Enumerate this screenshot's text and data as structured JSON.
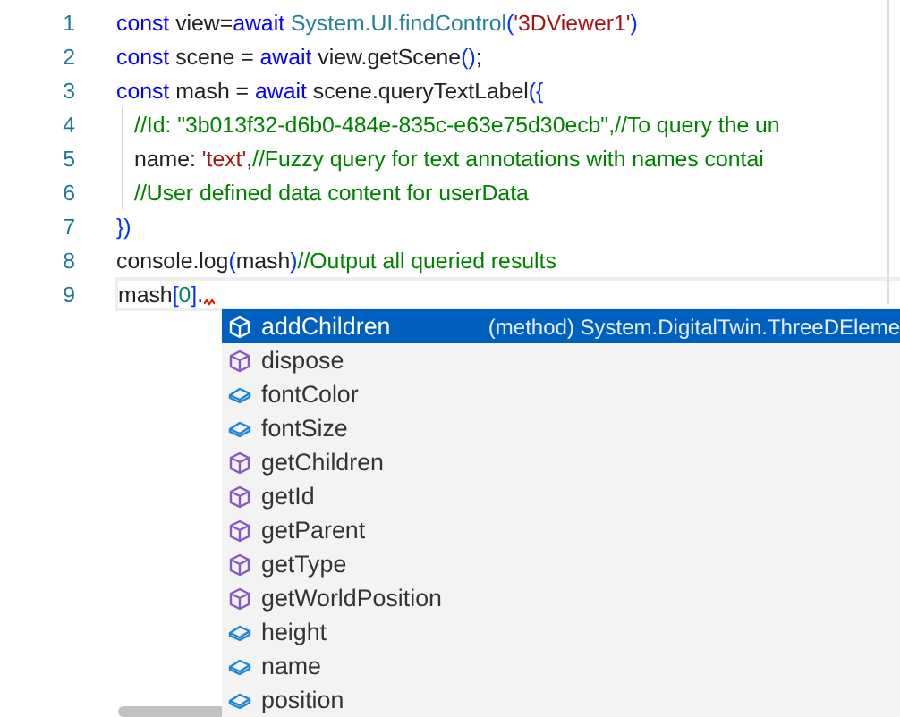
{
  "editor": {
    "lines": [
      {
        "number": "1",
        "indent": false,
        "tokens": [
          {
            "kind": "keyword",
            "text": "const"
          },
          {
            "kind": "plain",
            "text": " view="
          },
          {
            "kind": "keyword",
            "text": "await"
          },
          {
            "kind": "type",
            "text": " System.UI.findControl"
          },
          {
            "kind": "bracket",
            "text": "("
          },
          {
            "kind": "string",
            "text": "'3DViewer1'"
          },
          {
            "kind": "bracket",
            "text": ")"
          }
        ]
      },
      {
        "number": "2",
        "indent": false,
        "tokens": [
          {
            "kind": "keyword",
            "text": "const"
          },
          {
            "kind": "plain",
            "text": " scene = "
          },
          {
            "kind": "keyword",
            "text": "await"
          },
          {
            "kind": "plain",
            "text": " view.getScene"
          },
          {
            "kind": "bracket",
            "text": "()"
          },
          {
            "kind": "plain",
            "text": ";"
          }
        ]
      },
      {
        "number": "3",
        "indent": false,
        "tokens": [
          {
            "kind": "keyword",
            "text": "const"
          },
          {
            "kind": "plain",
            "text": " mash = "
          },
          {
            "kind": "keyword",
            "text": "await"
          },
          {
            "kind": "plain",
            "text": " scene.queryTextLabel"
          },
          {
            "kind": "bracket",
            "text": "({"
          }
        ]
      },
      {
        "number": "4",
        "indent": true,
        "tokens": [
          {
            "kind": "comment",
            "text": "//Id: \"3b013f32-d6b0-484e-835c-e63e75d30ecb\",//To query the un"
          }
        ]
      },
      {
        "number": "5",
        "indent": true,
        "tokens": [
          {
            "kind": "plain",
            "text": "name: "
          },
          {
            "kind": "string",
            "text": "'text'"
          },
          {
            "kind": "plain",
            "text": ","
          },
          {
            "kind": "comment",
            "text": "//Fuzzy query for text annotations with names contai"
          }
        ]
      },
      {
        "number": "6",
        "indent": true,
        "tokens": [
          {
            "kind": "comment",
            "text": "//User defined data content for userData"
          }
        ]
      },
      {
        "number": "7",
        "indent": false,
        "tokens": [
          {
            "kind": "bracket",
            "text": "})"
          }
        ]
      },
      {
        "number": "8",
        "indent": false,
        "tokens": [
          {
            "kind": "plain",
            "text": "console.log"
          },
          {
            "kind": "bracket",
            "text": "("
          },
          {
            "kind": "plain",
            "text": "mash"
          },
          {
            "kind": "bracket",
            "text": ")"
          },
          {
            "kind": "comment",
            "text": "//Output all queried results"
          }
        ]
      },
      {
        "number": "9",
        "indent": false,
        "current": true,
        "tokens": [
          {
            "kind": "plain",
            "text": "mash"
          },
          {
            "kind": "bracket",
            "text": "["
          },
          {
            "kind": "number",
            "text": "0"
          },
          {
            "kind": "bracket",
            "text": "]"
          },
          {
            "kind": "plain",
            "text": "."
          }
        ]
      }
    ]
  },
  "suggestions": [
    {
      "kind": "method",
      "label": "addChildren",
      "selected": true,
      "detail": "(method) System.DigitalTwin.ThreeDEleme"
    },
    {
      "kind": "method",
      "label": "dispose",
      "selected": false
    },
    {
      "kind": "property",
      "label": "fontColor",
      "selected": false
    },
    {
      "kind": "property",
      "label": "fontSize",
      "selected": false
    },
    {
      "kind": "method",
      "label": "getChildren",
      "selected": false
    },
    {
      "kind": "method",
      "label": "getId",
      "selected": false
    },
    {
      "kind": "method",
      "label": "getParent",
      "selected": false
    },
    {
      "kind": "method",
      "label": "getType",
      "selected": false
    },
    {
      "kind": "method",
      "label": "getWorldPosition",
      "selected": false
    },
    {
      "kind": "property",
      "label": "height",
      "selected": false
    },
    {
      "kind": "property",
      "label": "name",
      "selected": false
    },
    {
      "kind": "property",
      "label": "position",
      "selected": false
    }
  ]
}
